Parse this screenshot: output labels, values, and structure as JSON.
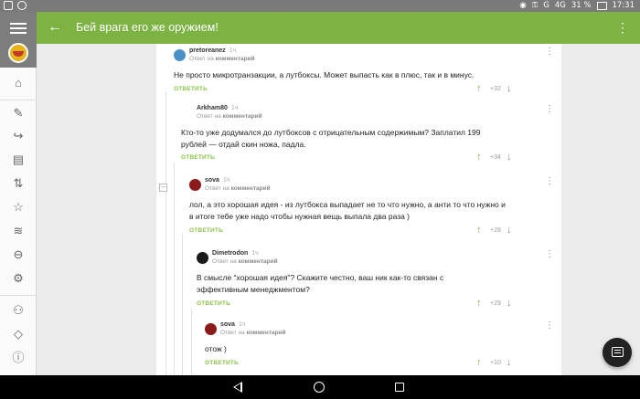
{
  "statusbar": {
    "time": "17:31",
    "battery": "31 %",
    "network": "4G",
    "carrier_letter": "G"
  },
  "appbar": {
    "title": "Бей врага его же оружием!"
  },
  "rail": {
    "icons": [
      "home-icon",
      "edit-icon",
      "share-icon",
      "comments-icon",
      "sort-icon",
      "star-icon",
      "rss-icon",
      "minus-circle-icon",
      "settings-icon",
      "users-icon",
      "tag-icon",
      "info-icon"
    ]
  },
  "comments": [
    {
      "author": "pretoreanez",
      "time": "1ч",
      "reply_prefix": "Ответ на",
      "reply_target": "комментарий",
      "text": "Не просто микротранзакции, а лутбоксы. Может выпасть как в плюс, так и в минус.",
      "answer": "ОТВЕТИТЬ",
      "score": "+32",
      "avatar_color": "#4a90c8"
    },
    {
      "author": "Arkham80",
      "time": "1ч",
      "reply_prefix": "Ответ на",
      "reply_target": "комментарий",
      "text": "Кто-то уже додумался до лутбоксов с отрицательным содержимым? Заплатил 199 рублей — отдай скин ножа, падла.",
      "answer": "ОТВЕТИТЬ",
      "score": "+34",
      "avatar_color": "#ffffff"
    },
    {
      "author": "sova",
      "time": "1ч",
      "reply_prefix": "Ответ на",
      "reply_target": "комментарий",
      "text": "лол, а это хорошая идея - из лутбокса выпадает не то что нужно, а анти то что нужно и в итоге тебе уже надо чтобы нужная вещь выпала два раза )",
      "answer": "ОТВЕТИТЬ",
      "score": "+28",
      "avatar_color": "#8b1a1a"
    },
    {
      "author": "Dimetrodon",
      "time": "1ч",
      "reply_prefix": "Ответ на",
      "reply_target": "комментарий",
      "text": "В смысле \"хорошая идея\"? Скажите честно, ваш ник как-то связан с эффективным менеджментом?",
      "answer": "ОТВЕТИТЬ",
      "score": "+29",
      "avatar_color": "#1b1b1b"
    },
    {
      "author": "sova",
      "time": "1ч",
      "reply_prefix": "Ответ на",
      "reply_target": "комментарий",
      "text": "отож )",
      "answer": "ОТВЕТИТЬ",
      "score": "+10",
      "avatar_color": "#8b1a1a"
    }
  ],
  "collapse_symbol": "–"
}
